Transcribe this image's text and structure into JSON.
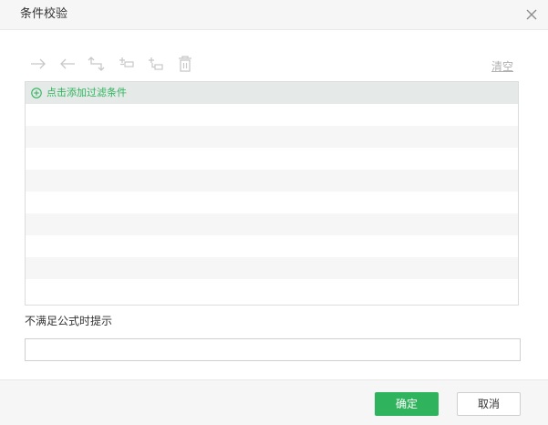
{
  "dialog": {
    "title": "条件校验",
    "close_icon": "close-icon"
  },
  "toolbar": {
    "buttons": [
      {
        "icon": "arrow-right-icon",
        "enabled": false
      },
      {
        "icon": "arrow-left-icon",
        "enabled": false
      },
      {
        "icon": "return-arrow-icon",
        "enabled": false
      },
      {
        "icon": "add-above-icon",
        "enabled": false
      },
      {
        "icon": "add-below-icon",
        "enabled": false
      },
      {
        "icon": "trash-icon",
        "enabled": false
      }
    ],
    "clear_label": "清空"
  },
  "filter_list": {
    "add_label": "点击添加过滤条件",
    "add_icon": "plus-circle-icon"
  },
  "formula": {
    "label": "不满足公式时提示",
    "value": "",
    "placeholder": ""
  },
  "footer": {
    "ok_label": "确定",
    "cancel_label": "取消"
  },
  "colors": {
    "accent": "#2fb45d",
    "header_bg": "#f6f6f6",
    "row_alt": "#f6f6f6",
    "add_row_bg": "#e5e9e8",
    "disabled_icon": "#c8c8c8"
  }
}
